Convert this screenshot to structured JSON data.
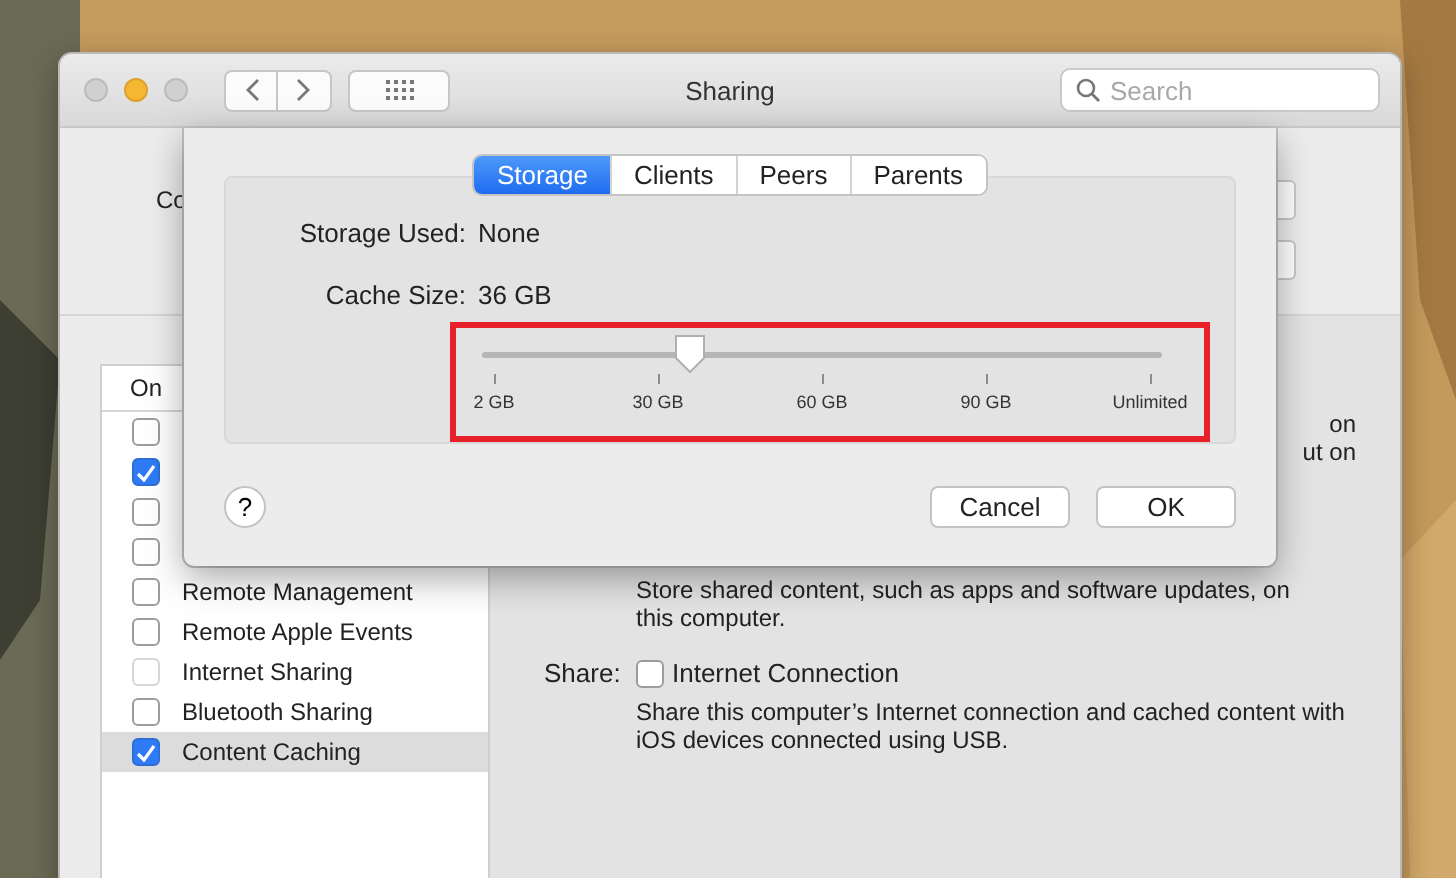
{
  "window": {
    "title": "Sharing",
    "search": {
      "placeholder": "Search"
    }
  },
  "background": {
    "label_fragment": "Co",
    "right_fragments": [
      "on",
      "ut on"
    ]
  },
  "services": {
    "header": "On",
    "items": [
      {
        "checked": false,
        "disabled": false,
        "selected": false
      },
      {
        "checked": true,
        "disabled": false,
        "selected": false
      },
      {
        "checked": false,
        "disabled": false,
        "selected": false
      },
      {
        "checked": false,
        "disabled": false,
        "selected": false
      },
      {
        "label": "Remote Management",
        "checked": false,
        "disabled": false,
        "selected": false
      },
      {
        "label": "Remote Apple Events",
        "checked": false,
        "disabled": false,
        "selected": false
      },
      {
        "label": "Internet Sharing",
        "checked": false,
        "disabled": true,
        "selected": false
      },
      {
        "label": "Bluetooth Sharing",
        "checked": false,
        "disabled": false,
        "selected": false
      },
      {
        "label": "Content Caching",
        "checked": true,
        "disabled": false,
        "selected": true
      }
    ]
  },
  "detail": {
    "description": "Store shared content, such as apps and software updates, on this computer.",
    "share_label": "Share:",
    "share_option": {
      "label": "Internet Connection",
      "checked": false
    },
    "share_description": "Share this computer’s Internet connection and cached content with iOS devices connected using USB."
  },
  "sheet": {
    "tabs": [
      {
        "label": "Storage",
        "selected": true
      },
      {
        "label": "Clients",
        "selected": false
      },
      {
        "label": "Peers",
        "selected": false
      },
      {
        "label": "Parents",
        "selected": false
      }
    ],
    "fields": [
      {
        "label": "Storage Used:",
        "value": "None"
      },
      {
        "label": "Cache Size:",
        "value": "36 GB"
      }
    ],
    "slider": {
      "level": 0.306,
      "highlighted": true,
      "ticks": [
        "2 GB",
        "30 GB",
        "60 GB",
        "90 GB",
        "Unlimited"
      ]
    },
    "help": "?",
    "buttons": [
      "Cancel",
      "OK"
    ]
  }
}
